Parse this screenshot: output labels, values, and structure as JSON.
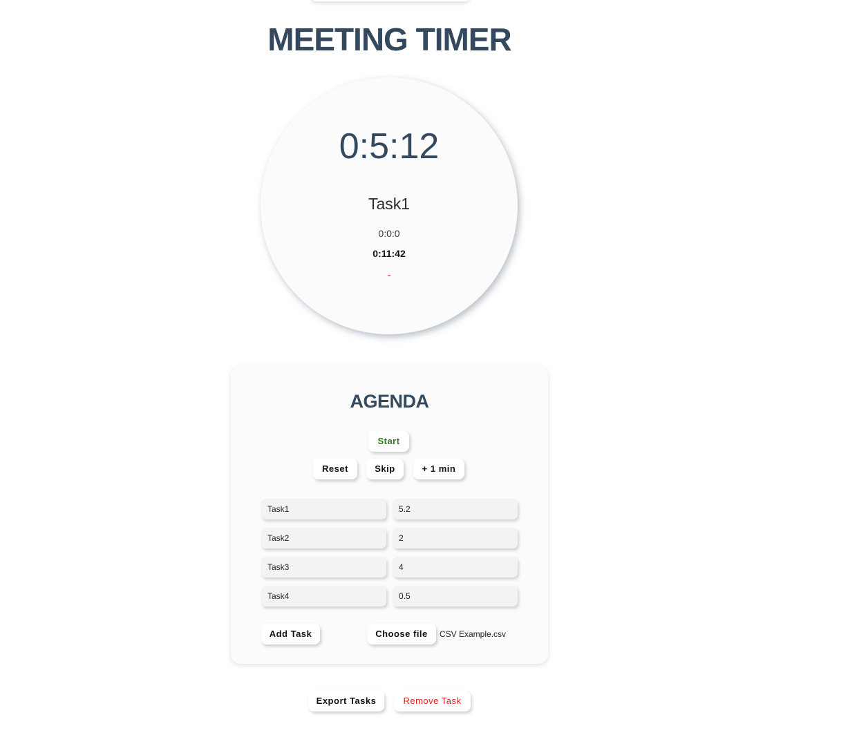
{
  "header": {
    "title": "MEETING TIMER"
  },
  "clock": {
    "remaining": "0:5:12",
    "current_task": "Task1",
    "elapsed": "0:0:0",
    "total": "0:11:42",
    "difference": "-"
  },
  "agenda": {
    "title": "AGENDA",
    "start_label": "Start",
    "reset_label": "Reset",
    "skip_label": "Skip",
    "add_minute_label": "+ 1 min",
    "tasks": [
      {
        "name": "Task1",
        "duration": "5.2"
      },
      {
        "name": "Task2",
        "duration": "2"
      },
      {
        "name": "Task3",
        "duration": "4"
      },
      {
        "name": "Task4",
        "duration": "0.5"
      }
    ],
    "add_task_label": "Add Task",
    "choose_file_label": "Choose file",
    "file_name": "CSV Example.csv"
  },
  "footer": {
    "export_label": "Export Tasks",
    "remove_label": "Remove Task"
  },
  "colors": {
    "accent": "#34495e",
    "start_green": "#2e7d1f",
    "danger_red": "#e02020"
  }
}
